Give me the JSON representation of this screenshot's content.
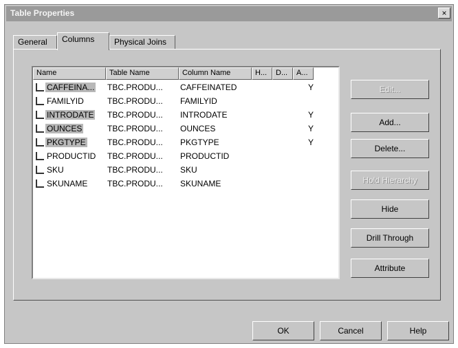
{
  "window": {
    "title": "Table Properties",
    "close_label": "×"
  },
  "tabs": [
    {
      "label": "General"
    },
    {
      "label": "Columns"
    },
    {
      "label": "Physical Joins"
    }
  ],
  "list": {
    "headers": [
      "Name",
      "Table Name",
      "Column Name",
      "H...",
      "D...",
      "A..."
    ],
    "rows": [
      {
        "name": "CAFFEINA...",
        "table": "TBC.PRODU...",
        "column": "CAFFEINATED",
        "a": "Y",
        "selected": true
      },
      {
        "name": "FAMILYID",
        "table": "TBC.PRODU...",
        "column": "FAMILYID",
        "a": "",
        "selected": false
      },
      {
        "name": "INTRODATE",
        "table": "TBC.PRODU...",
        "column": "INTRODATE",
        "a": "Y",
        "selected": true
      },
      {
        "name": "OUNCES",
        "table": "TBC.PRODU...",
        "column": "OUNCES",
        "a": "Y",
        "selected": true
      },
      {
        "name": "PKGTYPE",
        "table": "TBC.PRODU...",
        "column": "PKGTYPE",
        "a": "Y",
        "selected": true
      },
      {
        "name": "PRODUCTID",
        "table": "TBC.PRODU...",
        "column": "PRODUCTID",
        "a": "",
        "selected": false
      },
      {
        "name": "SKU",
        "table": "TBC.PRODU...",
        "column": "SKU",
        "a": "",
        "selected": false
      },
      {
        "name": "SKUNAME",
        "table": "TBC.PRODU...",
        "column": "SKUNAME",
        "a": "",
        "selected": false
      }
    ]
  },
  "side_buttons": {
    "edit": "Edit...",
    "add": "Add...",
    "delete": "Delete...",
    "hierarchy": "Hold Hierarchy",
    "hide": "Hide",
    "drill": "Drill Through",
    "attribute": "Attribute"
  },
  "footer": {
    "ok": "OK",
    "cancel": "Cancel",
    "help": "Help"
  }
}
